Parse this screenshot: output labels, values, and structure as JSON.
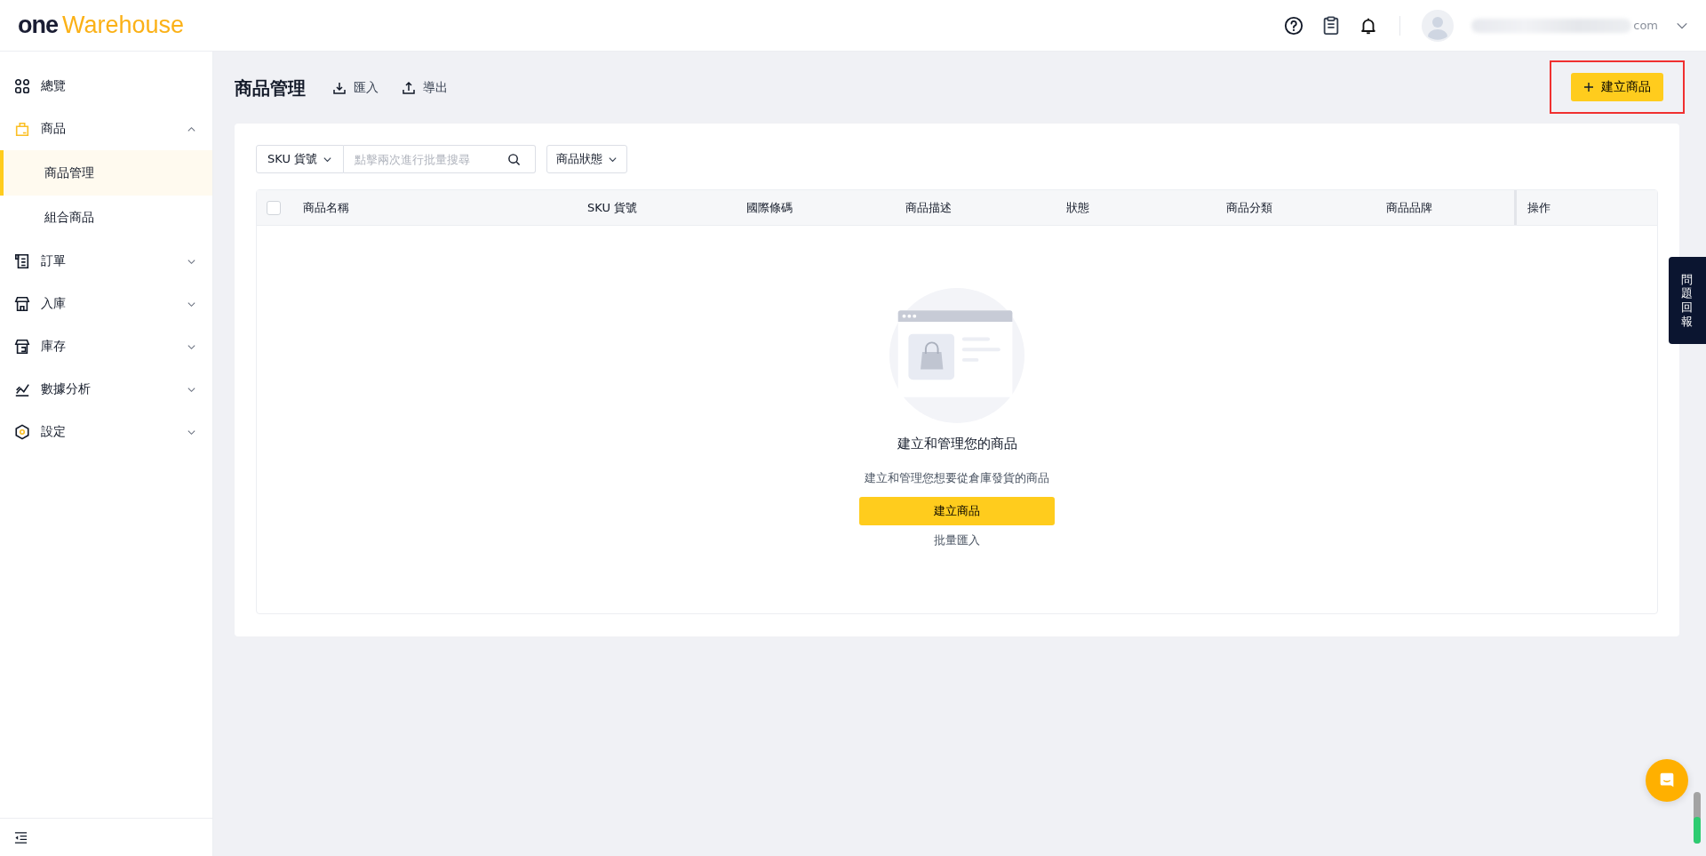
{
  "header": {
    "logo": {
      "part_1": "one",
      "part_2": "Warehouse"
    },
    "user": {
      "email_tail": "com"
    }
  },
  "sidebar": {
    "items": [
      {
        "label": "總覽",
        "kind": "link"
      },
      {
        "label": "商品",
        "kind": "group",
        "expanded": true,
        "children": [
          {
            "label": "商品管理",
            "selected": true
          },
          {
            "label": "組合商品",
            "selected": false
          }
        ]
      },
      {
        "label": "訂單",
        "kind": "group",
        "expanded": false
      },
      {
        "label": "入庫",
        "kind": "group",
        "expanded": false
      },
      {
        "label": "庫存",
        "kind": "group",
        "expanded": false
      },
      {
        "label": "數據分析",
        "kind": "group",
        "expanded": false
      },
      {
        "label": "設定",
        "kind": "group",
        "expanded": false
      }
    ]
  },
  "page": {
    "title": "商品管理",
    "actions": [
      "匯入",
      "導出"
    ],
    "create_button": "建立商品"
  },
  "filters": {
    "sku_select": "SKU 貨號",
    "search": {
      "placeholder": "點擊兩次進行批量搜尋"
    },
    "status_select": "商品狀態"
  },
  "table": {
    "select_all": {
      "checked": false
    },
    "columns": [
      "商品名稱",
      "SKU 貨號",
      "國際條碼",
      "商品描述",
      "狀態",
      "商品分類",
      "商品品牌",
      "操作"
    ]
  },
  "empty_state": {
    "title": "建立和管理您的商品",
    "subtitle": "建立和管理您想要從倉庫發貨的商品",
    "button": "建立商品",
    "link": "批量匯入"
  },
  "feedback_tab": "問題回報"
}
